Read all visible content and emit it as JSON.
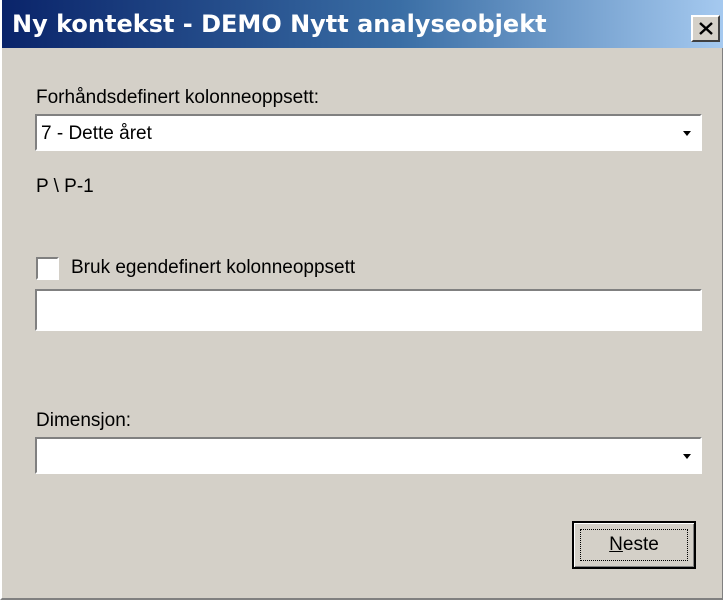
{
  "window": {
    "title": "Ny kontekst - DEMO Nytt analyseobjekt",
    "close_icon": "close-icon"
  },
  "column_setup": {
    "label": "Forhåndsdefinert kolonneoppsett:",
    "selected": "7 - Dette året",
    "formula": "P \\ P-1"
  },
  "custom": {
    "checkbox_label": "Bruk egendefinert kolonneoppsett",
    "checked": false,
    "value": ""
  },
  "dimension": {
    "label": "Dimensjon:",
    "selected": ""
  },
  "buttons": {
    "next_mnemonic": "N",
    "next_rest": "este"
  },
  "colors": {
    "titlebar_start": "#0a246a",
    "titlebar_end": "#a6caf0",
    "face": "#d4d0c8"
  }
}
